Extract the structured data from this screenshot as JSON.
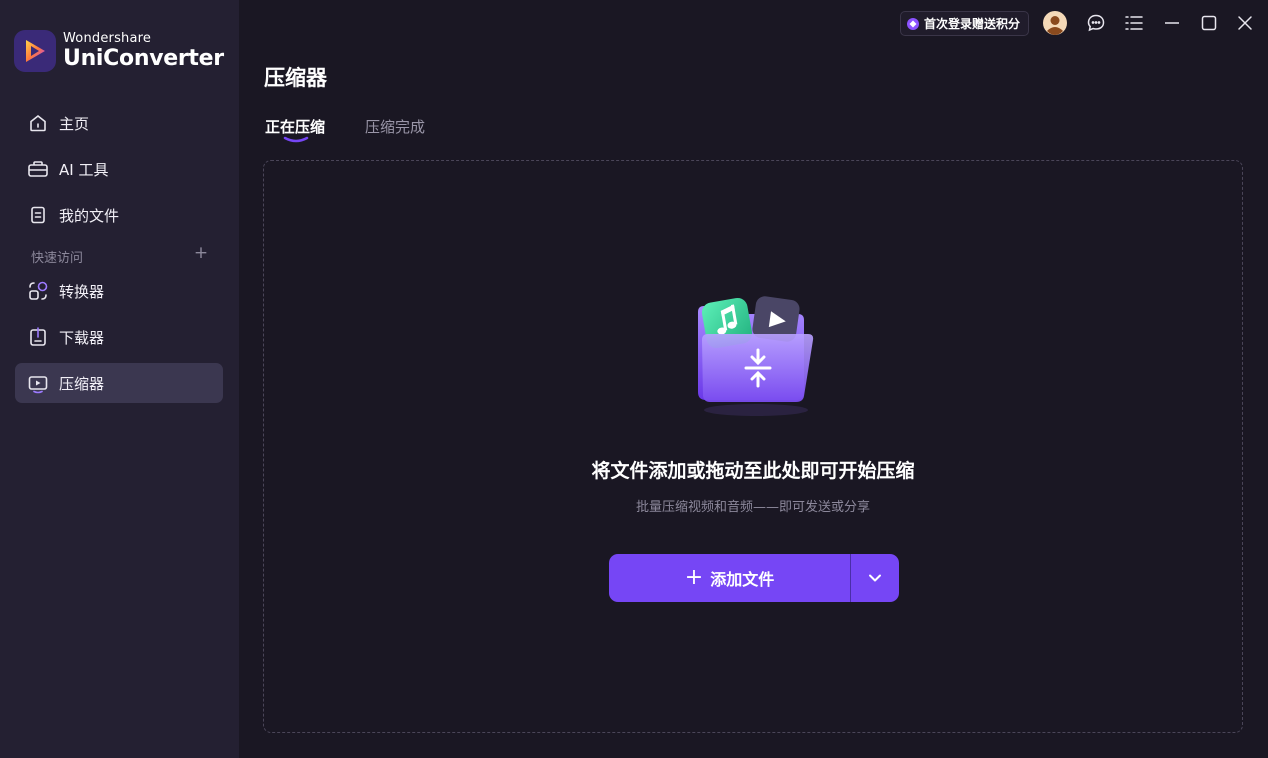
{
  "brand": {
    "top": "Wondershare",
    "main": "UniConverter"
  },
  "sidebar": {
    "items": [
      {
        "label": "主页",
        "icon": "home-icon"
      },
      {
        "label": "AI 工具",
        "icon": "ai-toolbox-icon"
      },
      {
        "label": "我的文件",
        "icon": "file-icon"
      }
    ],
    "quick_access_label": "快速访问",
    "quick_items": [
      {
        "label": "转换器",
        "icon": "converter-icon"
      },
      {
        "label": "下载器",
        "icon": "downloader-icon"
      },
      {
        "label": "压缩器",
        "icon": "compressor-icon",
        "active": true
      }
    ]
  },
  "topbar": {
    "promo": "首次登录赠送积分"
  },
  "main": {
    "title": "压缩器",
    "tabs": [
      {
        "label": "正在压缩",
        "active": true
      },
      {
        "label": "压缩完成",
        "active": false
      }
    ],
    "drop_title": "将文件添加或拖动至此处即可开始压缩",
    "drop_sub": "批量压缩视频和音频——即可发送或分享",
    "add_button": "添加文件"
  },
  "colors": {
    "accent": "#7646f5",
    "sidebar_bg": "#242032",
    "main_bg": "#1a1723",
    "active_item_bg": "#3b3750"
  }
}
